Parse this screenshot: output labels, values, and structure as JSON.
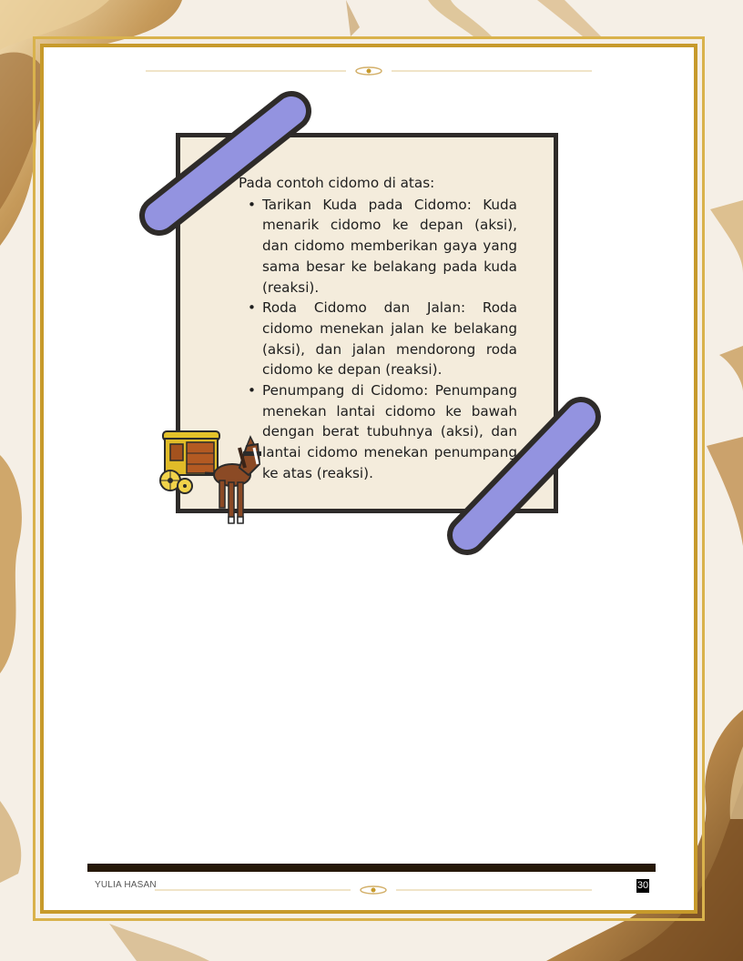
{
  "card": {
    "intro": "Pada contoh cidomo di atas:",
    "bullets": [
      "Tarikan Kuda pada Cidomo: Kuda menarik cidomo ke depan (aksi), dan cidomo memberikan gaya yang sama besar ke belakang pada kuda (reaksi).",
      "Roda Cidomo dan Jalan: Roda cidomo menekan jalan ke belakang (aksi), dan jalan mendorong roda cidomo ke depan (reaksi).",
      "Penumpang di Cidomo: Penumpang menekan lantai cidomo ke bawah dengan berat tubuhnya (aksi), dan lantai cidomo menekan penumpang ke atas (reaksi)."
    ]
  },
  "footer": {
    "author": "YULIA HASAN",
    "page_number": "30"
  },
  "colors": {
    "tape": "#9393e0",
    "frame_gold": "#c79a2b",
    "card_bg": "#f4ecdc"
  }
}
